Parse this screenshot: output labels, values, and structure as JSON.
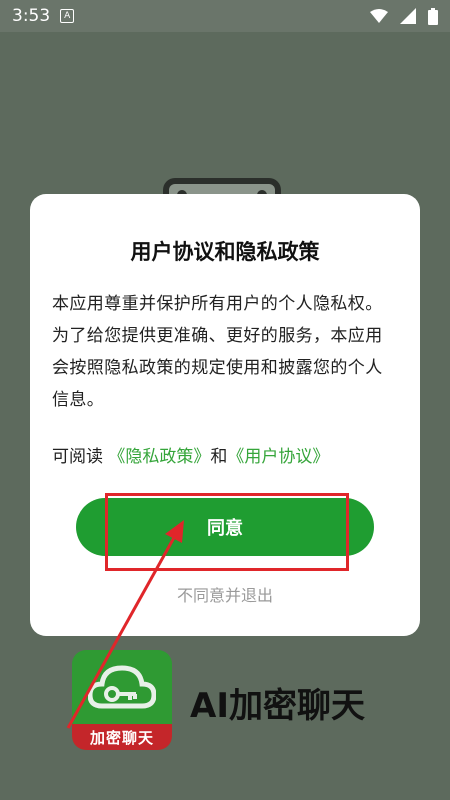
{
  "status_bar": {
    "time": "3:53",
    "notification_glyph": "A",
    "icons": [
      "wifi-icon",
      "signal-icon",
      "battery-icon"
    ]
  },
  "dialog": {
    "title": "用户协议和隐私政策",
    "body": "本应用尊重并保护所有用户的个人隐私权。为了给您提供更准确、更好的服务，本应用会按照隐私政策的规定使用和披露您的个人信息。",
    "links_prefix": "可阅读 ",
    "privacy_link": "《隐私政策》",
    "links_joiner": "和",
    "agreement_link": "《用户协议》",
    "agree_label": "同意",
    "disagree_label": "不同意并退出"
  },
  "background_app": {
    "logo_ribbon": "加密聊天",
    "name": "AI加密聊天"
  },
  "colors": {
    "accent": "#1f9d31",
    "link": "#35a53a",
    "annotation": "#e0262a"
  }
}
